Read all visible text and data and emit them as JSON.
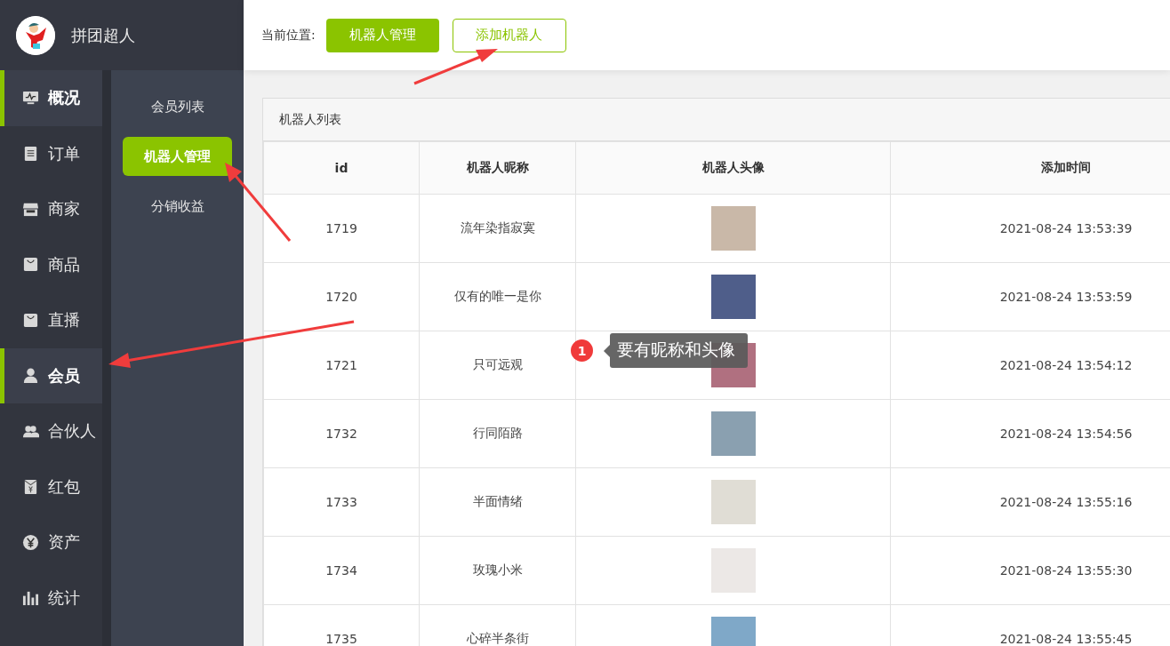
{
  "brand": {
    "name": "拼团超人"
  },
  "nav": [
    {
      "label": "概况",
      "selected": true
    },
    {
      "label": "订单",
      "selected": false
    },
    {
      "label": "商家",
      "selected": false
    },
    {
      "label": "商品",
      "selected": false
    },
    {
      "label": "直播",
      "selected": false
    },
    {
      "label": "会员",
      "selected": true
    },
    {
      "label": "合伙人",
      "selected": false
    },
    {
      "label": "红包",
      "selected": false
    },
    {
      "label": "资产",
      "selected": false
    },
    {
      "label": "统计",
      "selected": false
    }
  ],
  "subnav": [
    {
      "label": "会员列表",
      "selected": false
    },
    {
      "label": "机器人管理",
      "selected": true
    },
    {
      "label": "分销收益",
      "selected": false
    }
  ],
  "breadcrumb": {
    "label": "当前位置:",
    "current": "机器人管理",
    "action": "添加机器人"
  },
  "panel": {
    "title": "机器人列表"
  },
  "table": {
    "columns": [
      "id",
      "机器人昵称",
      "机器人头像",
      "添加时间"
    ],
    "rows": [
      {
        "id": "1719",
        "nickname": "流年染指寂寞",
        "added": "2021-08-24 13:53:39"
      },
      {
        "id": "1720",
        "nickname": "仅有的唯一是你",
        "added": "2021-08-24 13:53:59"
      },
      {
        "id": "1721",
        "nickname": "只可远观",
        "added": "2021-08-24 13:54:12"
      },
      {
        "id": "1732",
        "nickname": "行同陌路",
        "added": "2021-08-24 13:54:56"
      },
      {
        "id": "1733",
        "nickname": "半面情绪",
        "added": "2021-08-24 13:55:16"
      },
      {
        "id": "1734",
        "nickname": "玫瑰小米",
        "added": "2021-08-24 13:55:30"
      },
      {
        "id": "1735",
        "nickname": "心碎半条街",
        "added": "2021-08-24 13:55:45"
      }
    ]
  },
  "annotation": {
    "number": "1",
    "text": "要有昵称和头像"
  }
}
